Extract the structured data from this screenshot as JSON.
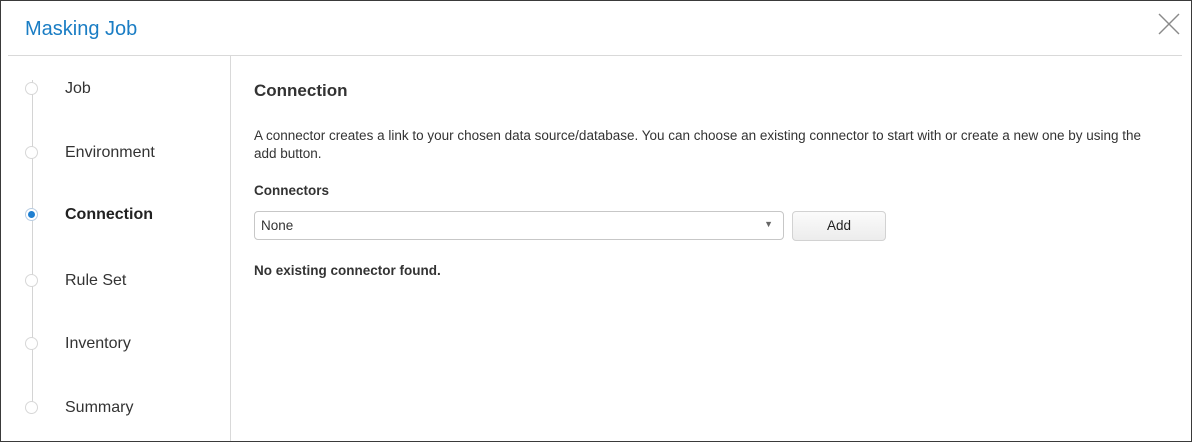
{
  "dialog": {
    "title": "Masking Job"
  },
  "steps": [
    {
      "label": "Job",
      "active": false
    },
    {
      "label": "Environment",
      "active": false
    },
    {
      "label": "Connection",
      "active": true
    },
    {
      "label": "Rule Set",
      "active": false
    },
    {
      "label": "Inventory",
      "active": false
    },
    {
      "label": "Summary",
      "active": false
    }
  ],
  "main": {
    "section_title": "Connection",
    "description": "A connector creates a link to your chosen data source/database. You can choose an existing connector to start with or create a new one by using the add button.",
    "connectors_label": "Connectors",
    "connector_select_value": "None",
    "add_button_label": "Add",
    "empty_message": "No existing connector found."
  },
  "colors": {
    "title_blue": "#1a7dc4",
    "active_step_dot": "#1f7fd1"
  }
}
